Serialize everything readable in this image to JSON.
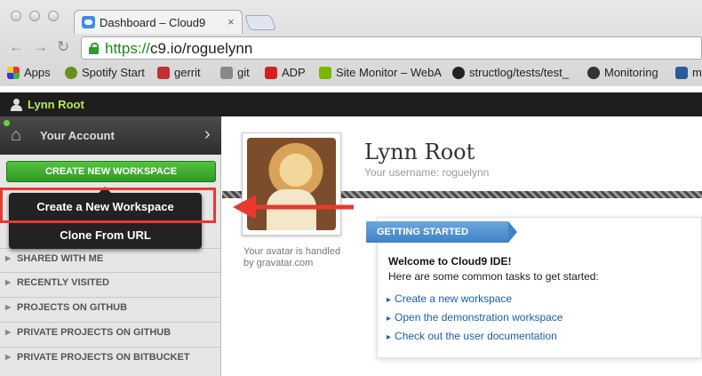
{
  "browser": {
    "tab_title": "Dashboard – Cloud9",
    "tab_close": "×",
    "url_scheme": "https://",
    "url_rest": "c9.io/roguelynn",
    "bookmarks": [
      {
        "label": "Apps",
        "color": "#e0a020"
      },
      {
        "label": "Spotify Start",
        "color": "#6a8f1f"
      },
      {
        "label": "gerrit",
        "color": "#c03030"
      },
      {
        "label": "git",
        "color": "#444444"
      },
      {
        "label": "ADP",
        "color": "#d32020"
      },
      {
        "label": "Site Monitor – WebA",
        "color": "#7ab800"
      },
      {
        "label": "structlog/tests/test_",
        "color": "#222222"
      },
      {
        "label": "Monitoring",
        "color": "#333333"
      },
      {
        "label": "m",
        "color": "#2a5a9a"
      }
    ]
  },
  "topbar": {
    "user": "Lynn Root"
  },
  "sidebar": {
    "account": "Your Account",
    "create_button": "CREATE NEW WORKSPACE",
    "items": [
      {
        "label": "SHARED WITH ME"
      },
      {
        "label": "RECENTLY VISITED"
      },
      {
        "label": "PROJECTS ON GITHUB"
      },
      {
        "label": "PRIVATE PROJECTS ON GITHUB"
      },
      {
        "label": "PRIVATE PROJECTS ON BITBUCKET"
      }
    ]
  },
  "dropdown": {
    "items": [
      {
        "label": "Create a New Workspace"
      },
      {
        "label": "Clone From URL"
      }
    ]
  },
  "profile": {
    "name": "Lynn Root",
    "username_line": "Your username: roguelynn",
    "avatar_caption_1": "Your avatar is handled",
    "avatar_caption_2": "by gravatar.com"
  },
  "getting_started": {
    "banner": "GETTING STARTED",
    "welcome": "Welcome to Cloud9 IDE!",
    "subtitle": "Here are some common tasks to get started:",
    "links": [
      {
        "label": "Create a new workspace"
      },
      {
        "label": "Open the demonstration workspace"
      },
      {
        "label": "Check out the user documentation"
      }
    ]
  },
  "colors": {
    "annotation": "#e8392f",
    "accent_green": "#3aae2c",
    "link": "#1a5ea8"
  }
}
